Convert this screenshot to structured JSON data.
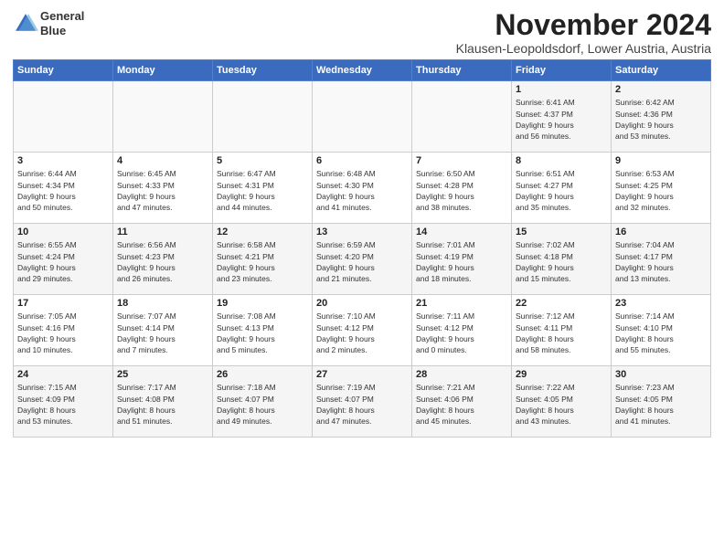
{
  "header": {
    "logo_line1": "General",
    "logo_line2": "Blue",
    "month_title": "November 2024",
    "subtitle": "Klausen-Leopoldsdorf, Lower Austria, Austria"
  },
  "weekdays": [
    "Sunday",
    "Monday",
    "Tuesday",
    "Wednesday",
    "Thursday",
    "Friday",
    "Saturday"
  ],
  "weeks": [
    [
      {
        "day": "",
        "info": ""
      },
      {
        "day": "",
        "info": ""
      },
      {
        "day": "",
        "info": ""
      },
      {
        "day": "",
        "info": ""
      },
      {
        "day": "",
        "info": ""
      },
      {
        "day": "1",
        "info": "Sunrise: 6:41 AM\nSunset: 4:37 PM\nDaylight: 9 hours\nand 56 minutes."
      },
      {
        "day": "2",
        "info": "Sunrise: 6:42 AM\nSunset: 4:36 PM\nDaylight: 9 hours\nand 53 minutes."
      }
    ],
    [
      {
        "day": "3",
        "info": "Sunrise: 6:44 AM\nSunset: 4:34 PM\nDaylight: 9 hours\nand 50 minutes."
      },
      {
        "day": "4",
        "info": "Sunrise: 6:45 AM\nSunset: 4:33 PM\nDaylight: 9 hours\nand 47 minutes."
      },
      {
        "day": "5",
        "info": "Sunrise: 6:47 AM\nSunset: 4:31 PM\nDaylight: 9 hours\nand 44 minutes."
      },
      {
        "day": "6",
        "info": "Sunrise: 6:48 AM\nSunset: 4:30 PM\nDaylight: 9 hours\nand 41 minutes."
      },
      {
        "day": "7",
        "info": "Sunrise: 6:50 AM\nSunset: 4:28 PM\nDaylight: 9 hours\nand 38 minutes."
      },
      {
        "day": "8",
        "info": "Sunrise: 6:51 AM\nSunset: 4:27 PM\nDaylight: 9 hours\nand 35 minutes."
      },
      {
        "day": "9",
        "info": "Sunrise: 6:53 AM\nSunset: 4:25 PM\nDaylight: 9 hours\nand 32 minutes."
      }
    ],
    [
      {
        "day": "10",
        "info": "Sunrise: 6:55 AM\nSunset: 4:24 PM\nDaylight: 9 hours\nand 29 minutes."
      },
      {
        "day": "11",
        "info": "Sunrise: 6:56 AM\nSunset: 4:23 PM\nDaylight: 9 hours\nand 26 minutes."
      },
      {
        "day": "12",
        "info": "Sunrise: 6:58 AM\nSunset: 4:21 PM\nDaylight: 9 hours\nand 23 minutes."
      },
      {
        "day": "13",
        "info": "Sunrise: 6:59 AM\nSunset: 4:20 PM\nDaylight: 9 hours\nand 21 minutes."
      },
      {
        "day": "14",
        "info": "Sunrise: 7:01 AM\nSunset: 4:19 PM\nDaylight: 9 hours\nand 18 minutes."
      },
      {
        "day": "15",
        "info": "Sunrise: 7:02 AM\nSunset: 4:18 PM\nDaylight: 9 hours\nand 15 minutes."
      },
      {
        "day": "16",
        "info": "Sunrise: 7:04 AM\nSunset: 4:17 PM\nDaylight: 9 hours\nand 13 minutes."
      }
    ],
    [
      {
        "day": "17",
        "info": "Sunrise: 7:05 AM\nSunset: 4:16 PM\nDaylight: 9 hours\nand 10 minutes."
      },
      {
        "day": "18",
        "info": "Sunrise: 7:07 AM\nSunset: 4:14 PM\nDaylight: 9 hours\nand 7 minutes."
      },
      {
        "day": "19",
        "info": "Sunrise: 7:08 AM\nSunset: 4:13 PM\nDaylight: 9 hours\nand 5 minutes."
      },
      {
        "day": "20",
        "info": "Sunrise: 7:10 AM\nSunset: 4:12 PM\nDaylight: 9 hours\nand 2 minutes."
      },
      {
        "day": "21",
        "info": "Sunrise: 7:11 AM\nSunset: 4:12 PM\nDaylight: 9 hours\nand 0 minutes."
      },
      {
        "day": "22",
        "info": "Sunrise: 7:12 AM\nSunset: 4:11 PM\nDaylight: 8 hours\nand 58 minutes."
      },
      {
        "day": "23",
        "info": "Sunrise: 7:14 AM\nSunset: 4:10 PM\nDaylight: 8 hours\nand 55 minutes."
      }
    ],
    [
      {
        "day": "24",
        "info": "Sunrise: 7:15 AM\nSunset: 4:09 PM\nDaylight: 8 hours\nand 53 minutes."
      },
      {
        "day": "25",
        "info": "Sunrise: 7:17 AM\nSunset: 4:08 PM\nDaylight: 8 hours\nand 51 minutes."
      },
      {
        "day": "26",
        "info": "Sunrise: 7:18 AM\nSunset: 4:07 PM\nDaylight: 8 hours\nand 49 minutes."
      },
      {
        "day": "27",
        "info": "Sunrise: 7:19 AM\nSunset: 4:07 PM\nDaylight: 8 hours\nand 47 minutes."
      },
      {
        "day": "28",
        "info": "Sunrise: 7:21 AM\nSunset: 4:06 PM\nDaylight: 8 hours\nand 45 minutes."
      },
      {
        "day": "29",
        "info": "Sunrise: 7:22 AM\nSunset: 4:05 PM\nDaylight: 8 hours\nand 43 minutes."
      },
      {
        "day": "30",
        "info": "Sunrise: 7:23 AM\nSunset: 4:05 PM\nDaylight: 8 hours\nand 41 minutes."
      }
    ]
  ]
}
